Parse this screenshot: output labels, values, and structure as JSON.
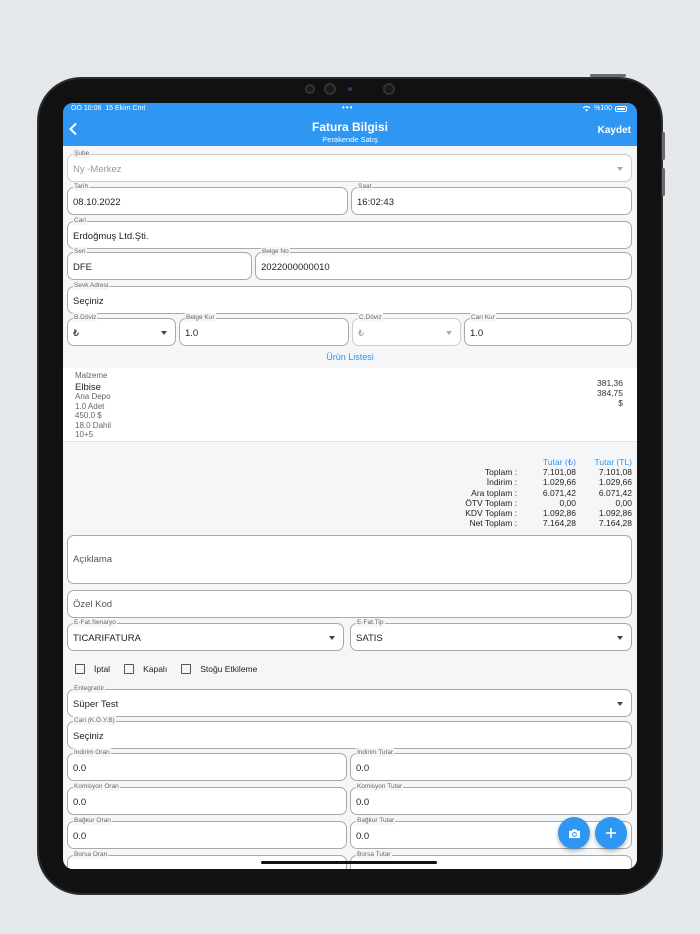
{
  "status": {
    "time": "ÖÖ 10:06",
    "date": "15 Ekim Cmt",
    "battery": "%100"
  },
  "header": {
    "title": "Fatura Bilgisi",
    "subtitle": "Perakende Satış",
    "save_label": "Kaydet"
  },
  "form": {
    "sube": {
      "label": "Şube",
      "value": "Ny -Merkez"
    },
    "tarih": {
      "label": "Tarih",
      "value": "08.10.2022"
    },
    "saat": {
      "label": "Saat",
      "value": "16:02:43"
    },
    "cari": {
      "label": "Cari",
      "value": "Erdoğmuş Ltd.Şti."
    },
    "seri": {
      "label": "Seri",
      "value": "DFE"
    },
    "belge_no": {
      "label": "Belge No",
      "value": "2022000000010"
    },
    "sevk_adresi": {
      "label": "Sevk Adresi",
      "value": "Seçiniz"
    },
    "b_doviz": {
      "label": "B.Döviz",
      "value": "₺"
    },
    "belge_kur": {
      "label": "Belge Kur",
      "value": "1.0"
    },
    "c_doviz": {
      "label": "C.Döviz",
      "value": "₺"
    },
    "cari_kur": {
      "label": "Cari Kur",
      "value": "1.0"
    }
  },
  "product_list_link": "Ürün Listesi",
  "product": {
    "header": "Malzeme",
    "name": "Elbise",
    "depot": "Ana Depo",
    "quantity": "1.0 Adet",
    "unit_price": "450.0 $",
    "vat": "18.0 Dahil",
    "discount": "10+5",
    "price1": "381,36",
    "price2": "384,75",
    "currency": "$"
  },
  "totals": {
    "header1": "Tutar (₺)",
    "header2": "Tutar (TL)",
    "rows": [
      {
        "label": "Toplam :",
        "v1": "7.101,08",
        "v2": "7.101,08"
      },
      {
        "label": "İndirim :",
        "v1": "1.029,66",
        "v2": "1.029,66"
      },
      {
        "label": "Ara toplam :",
        "v1": "6.071,42",
        "v2": "6.071,42"
      },
      {
        "label": "ÖTV Toplam :",
        "v1": "0,00",
        "v2": "0,00"
      },
      {
        "label": "KDV Toplam :",
        "v1": "1.092,86",
        "v2": "1.092,86"
      },
      {
        "label": "Net Toplam :",
        "v1": "7.164,28",
        "v2": "7.164,28"
      }
    ]
  },
  "form2": {
    "aciklama": {
      "placeholder": "Açıklama"
    },
    "ozel_kod": {
      "placeholder": "Özel Kod"
    },
    "efat_senaryo": {
      "label": "E-Fat.Senaryo",
      "value": "TICARIFATURA"
    },
    "efat_tip": {
      "label": "E-Fat.Tip",
      "value": "SATIS"
    },
    "checkboxes": {
      "iptal": "İptal",
      "kapali": "Kapalı",
      "stogu": "Stoğu Etkileme"
    },
    "entegrator": {
      "label": "Entegratör",
      "value": "Süper Test"
    },
    "cari_koyb": {
      "label": "Cari (K.Ö.Y.B)",
      "value": "Seçiniz"
    },
    "indirim_oran": {
      "label": "İndirim Oran",
      "value": "0.0"
    },
    "indirim_tutar": {
      "label": "İndirim Tutar",
      "value": "0.0"
    },
    "komisyon_oran": {
      "label": "Komisyon Oran",
      "value": "0.0"
    },
    "komisyon_tutar": {
      "label": "Komisyon Tutar",
      "value": "0.0"
    },
    "bagkur_oran": {
      "label": "Bağkur Oran",
      "value": "0.0"
    },
    "bagkur_tutar": {
      "label": "Bağkur Tutar",
      "value": "0.0"
    },
    "borsa_oran": {
      "label": "Borsa Oran"
    },
    "borsa_tutar": {
      "label": "Borsa Tutar"
    }
  },
  "colors": {
    "primary": "#2e96f3",
    "background": "#f5f6f8"
  }
}
